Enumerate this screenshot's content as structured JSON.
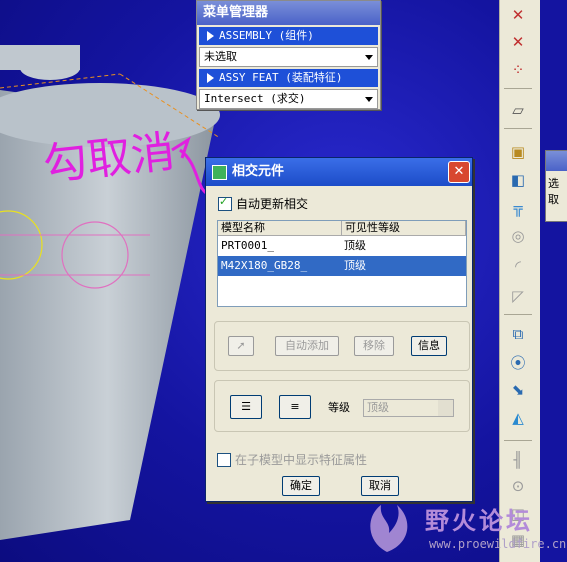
{
  "menu_manager": {
    "title": "菜单管理器",
    "item_assembly": "ASSEMBLY (组件)",
    "select_value": "未选取",
    "item_feat": "ASSY FEAT (装配特征)",
    "intersect_value": "Intersect (求交)"
  },
  "dialog": {
    "title": "相交元件",
    "auto_update_label": "自动更新相交",
    "auto_update_checked": true,
    "columns": [
      "模型名称",
      "可见性等级"
    ],
    "rows": [
      {
        "model": "PRT0001_",
        "level": "顶级",
        "selected": false
      },
      {
        "model": "M42X180_GB28_",
        "level": "顶级",
        "selected": true
      }
    ],
    "buttons": {
      "auto_add": "自动添加",
      "remove": "移除",
      "info": "信息",
      "ok": "确定",
      "cancel": "取消"
    },
    "level_label": "等级",
    "level_value": "顶级",
    "show_props_label": "在子模型中显示特征属性"
  },
  "annotation": {
    "handwritten": "勾取消",
    "color": "#e020e0"
  },
  "mini_panel": {
    "text": "选取"
  },
  "watermark": {
    "name": "野火论坛",
    "url": "www.proewildfire.cn"
  },
  "colors": {
    "background": "#1616a6",
    "title_bar": "#1c4cc8",
    "selected_row": "#316ac5"
  }
}
